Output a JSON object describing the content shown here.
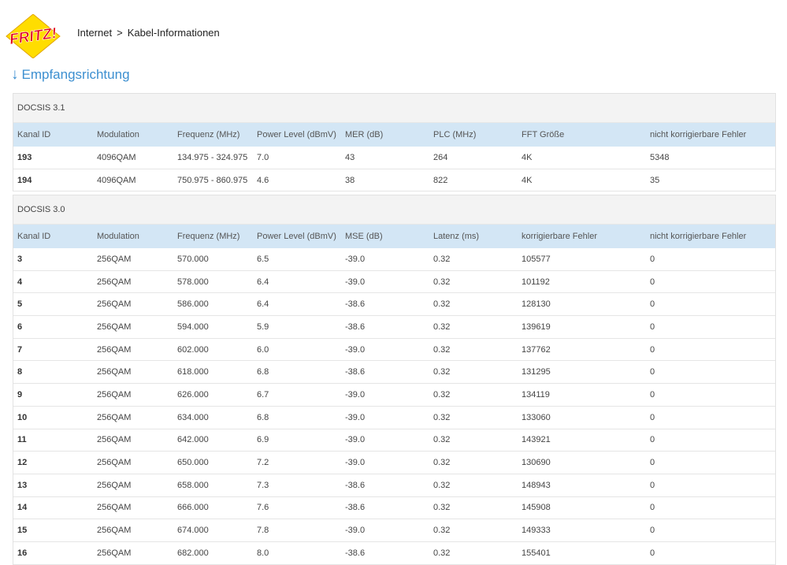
{
  "logo": {
    "text": "FRITZ!",
    "colors": {
      "red": "#e2001a",
      "yellow": "#ffdd00"
    }
  },
  "breadcrumb": {
    "items": [
      "Internet",
      "Kabel-Informationen"
    ],
    "separator": ">"
  },
  "section": {
    "arrow": "↓",
    "title": "Empfangsrichtung"
  },
  "colors": {
    "accent": "#3c8fd0",
    "header_bg": "#d3e6f5",
    "panel_head_bg": "#f3f3f3"
  },
  "docsis31": {
    "title": "DOCSIS 3.1",
    "columns": [
      "Kanal ID",
      "Modulation",
      "Frequenz (MHz)",
      "Power Level (dBmV)",
      "MER (dB)",
      "PLC (MHz)",
      "FFT Größe",
      "nicht korrigierbare Fehler"
    ],
    "rows": [
      [
        "193",
        "4096QAM",
        "134.975 - 324.975",
        "7.0",
        "43",
        "264",
        "4K",
        "5348"
      ],
      [
        "194",
        "4096QAM",
        "750.975 - 860.975",
        "4.6",
        "38",
        "822",
        "4K",
        "35"
      ]
    ]
  },
  "docsis30": {
    "title": "DOCSIS 3.0",
    "columns": [
      "Kanal ID",
      "Modulation",
      "Frequenz (MHz)",
      "Power Level (dBmV)",
      "MSE (dB)",
      "Latenz (ms)",
      "korrigierbare Fehler",
      "nicht korrigierbare Fehler"
    ],
    "rows": [
      [
        "3",
        "256QAM",
        "570.000",
        "6.5",
        "-39.0",
        "0.32",
        "105577",
        "0"
      ],
      [
        "4",
        "256QAM",
        "578.000",
        "6.4",
        "-39.0",
        "0.32",
        "101192",
        "0"
      ],
      [
        "5",
        "256QAM",
        "586.000",
        "6.4",
        "-38.6",
        "0.32",
        "128130",
        "0"
      ],
      [
        "6",
        "256QAM",
        "594.000",
        "5.9",
        "-38.6",
        "0.32",
        "139619",
        "0"
      ],
      [
        "7",
        "256QAM",
        "602.000",
        "6.0",
        "-39.0",
        "0.32",
        "137762",
        "0"
      ],
      [
        "8",
        "256QAM",
        "618.000",
        "6.8",
        "-38.6",
        "0.32",
        "131295",
        "0"
      ],
      [
        "9",
        "256QAM",
        "626.000",
        "6.7",
        "-39.0",
        "0.32",
        "134119",
        "0"
      ],
      [
        "10",
        "256QAM",
        "634.000",
        "6.8",
        "-39.0",
        "0.32",
        "133060",
        "0"
      ],
      [
        "11",
        "256QAM",
        "642.000",
        "6.9",
        "-39.0",
        "0.32",
        "143921",
        "0"
      ],
      [
        "12",
        "256QAM",
        "650.000",
        "7.2",
        "-39.0",
        "0.32",
        "130690",
        "0"
      ],
      [
        "13",
        "256QAM",
        "658.000",
        "7.3",
        "-38.6",
        "0.32",
        "148943",
        "0"
      ],
      [
        "14",
        "256QAM",
        "666.000",
        "7.6",
        "-38.6",
        "0.32",
        "145908",
        "0"
      ],
      [
        "15",
        "256QAM",
        "674.000",
        "7.8",
        "-39.0",
        "0.32",
        "149333",
        "0"
      ],
      [
        "16",
        "256QAM",
        "682.000",
        "8.0",
        "-38.6",
        "0.32",
        "155401",
        "0"
      ]
    ]
  }
}
